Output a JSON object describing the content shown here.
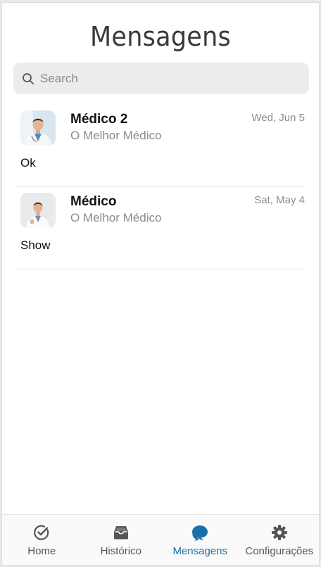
{
  "header": {
    "title": "Mensagens"
  },
  "search": {
    "placeholder": "Search"
  },
  "conversations": [
    {
      "name": "Médico 2",
      "subtitle": "O Melhor Médico",
      "date": "Wed, Jun 5",
      "message": "Ok"
    },
    {
      "name": "Médico",
      "subtitle": "O Melhor Médico",
      "date": "Sat, May 4",
      "message": "Show"
    }
  ],
  "tabbar": {
    "active": "Mensagens",
    "accent_color": "#1a6fa8",
    "items": [
      {
        "label": "Home",
        "icon": "check-circle-icon"
      },
      {
        "label": "Histórico",
        "icon": "archive-icon"
      },
      {
        "label": "Mensagens",
        "icon": "chat-bubbles-icon"
      },
      {
        "label": "Configurações",
        "icon": "gear-icon"
      }
    ]
  }
}
